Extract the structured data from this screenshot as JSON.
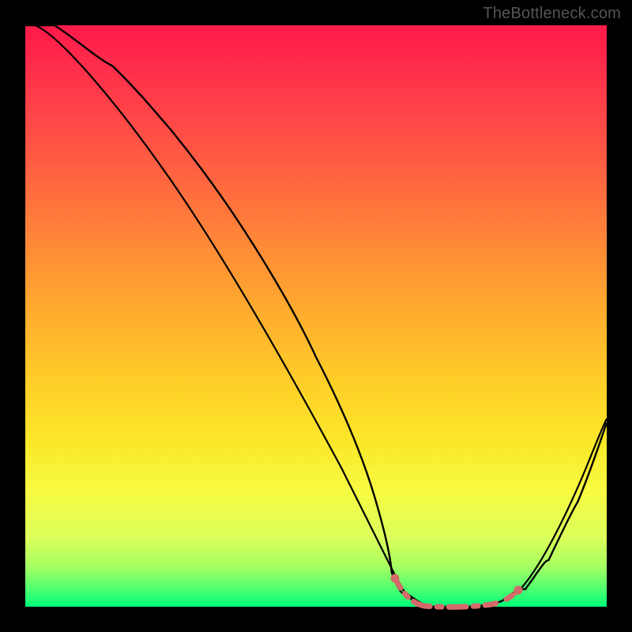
{
  "watermark": "TheBottleneck.com",
  "colors": {
    "frame": "#000000",
    "curve": "#000000",
    "marker": "#d46a6a",
    "gradient_top": "#ff1a4a",
    "gradient_bottom": "#00ff78"
  },
  "chart_data": {
    "type": "line",
    "title": "",
    "xlabel": "",
    "ylabel": "",
    "xlim": [
      0,
      100
    ],
    "ylim": [
      0,
      100
    ],
    "series": [
      {
        "name": "bottleneck-curve",
        "x": [
          0,
          5,
          10,
          15,
          20,
          25,
          30,
          35,
          40,
          45,
          50,
          55,
          60,
          63,
          66,
          70,
          74,
          78,
          82,
          86,
          90,
          95,
          100
        ],
        "y": [
          100,
          100,
          97,
          93,
          88,
          82,
          75,
          67,
          58,
          48,
          37,
          25,
          13,
          6,
          2,
          0,
          0,
          0,
          1,
          3,
          8,
          18,
          32
        ]
      }
    ],
    "marker_region": {
      "name": "optimal-range",
      "x": [
        63,
        66,
        70,
        74,
        78,
        82,
        85
      ],
      "y": [
        6,
        2,
        0,
        0,
        0,
        1,
        3
      ]
    }
  }
}
